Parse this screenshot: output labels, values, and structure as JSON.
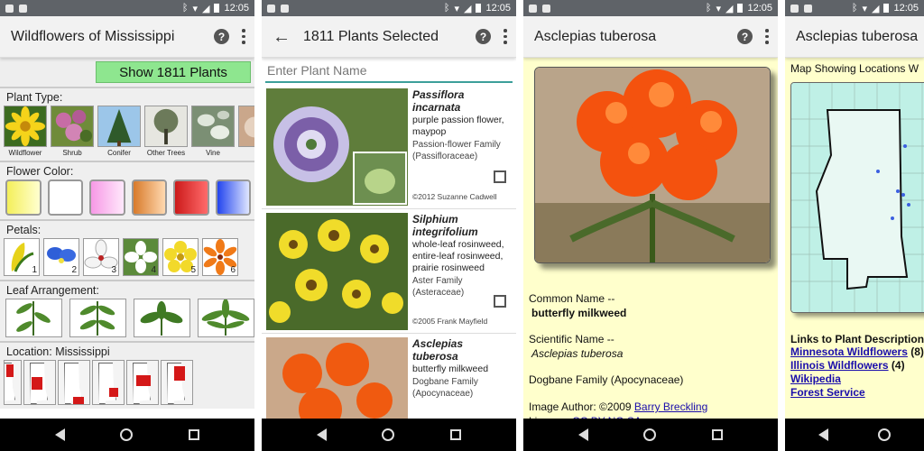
{
  "status": {
    "time": "12:05"
  },
  "screen1": {
    "title": "Wildflowers of Mississippi",
    "show_button": "Show 1811 Plants",
    "plant_type_label": "Plant Type:",
    "plant_types": [
      "Wildflower",
      "Shrub",
      "Conifer",
      "Other Trees",
      "Vine",
      ""
    ],
    "flower_color_label": "Flower Color:",
    "flower_colors": [
      {
        "name": "yellow",
        "from": "#f4ef5a",
        "to": "#ffffd0"
      },
      {
        "name": "white",
        "from": "#ffffff",
        "to": "#ffffff"
      },
      {
        "name": "pink",
        "from": "#f799e6",
        "to": "#ffe8fb"
      },
      {
        "name": "orange",
        "from": "#d87a2a",
        "to": "#ffd9b0"
      },
      {
        "name": "red",
        "from": "#cc1a1a",
        "to": "#ff6b6b"
      },
      {
        "name": "blue",
        "from": "#2244ee",
        "to": "#dfe6ff"
      }
    ],
    "petals_label": "Petals:",
    "petal_counts": [
      "1",
      "2",
      "3",
      "4",
      "5",
      "6"
    ],
    "leaf_label": "Leaf Arrangement:",
    "location_label": "Location: Mississippi"
  },
  "screen2": {
    "title": "1811 Plants Selected",
    "search_placeholder": "Enter Plant Name",
    "plants": [
      {
        "scientific": "Passiflora incarnata",
        "common": "purple passion flower, maypop",
        "family": "Passion-flower Family (Passifloraceae)",
        "credit": "©2012 Suzanne Cadwell"
      },
      {
        "scientific": "Silphium integrifolium",
        "common": "whole-leaf rosinweed, entire-leaf rosinweed, prairie rosinweed",
        "family": "Aster Family (Asteraceae)",
        "credit": "©2005 Frank Mayfield"
      },
      {
        "scientific": "Asclepias tuberosa",
        "common": "butterfly milkweed",
        "family": "Dogbane Family (Apocynaceae)",
        "credit": ""
      }
    ]
  },
  "screen3": {
    "title": "Asclepias tuberosa",
    "common_label": "Common Name --",
    "common_value": "butterfly milkweed",
    "sci_label": "Scientific Name --",
    "sci_value": "Asclepias tuberosa",
    "family": "Dogbane Family (Apocynaceae)",
    "author_prefix": "Image Author: ©2009 ",
    "author_link": "Barry Breckling",
    "license_prefix": "License: ",
    "license_link": "CC BY-NC-SA"
  },
  "screen4": {
    "title": "Asclepias tuberosa",
    "map_caption": "Map Showing Locations W",
    "links_heading": "Links to Plant Descriptions",
    "links": [
      {
        "label": "Minnesota Wildflowers",
        "count": " (8)"
      },
      {
        "label": "Illinois Wildflowers",
        "count": " (4)"
      },
      {
        "label": "Wikipedia",
        "count": ""
      },
      {
        "label": "Forest Service",
        "count": ""
      }
    ]
  }
}
